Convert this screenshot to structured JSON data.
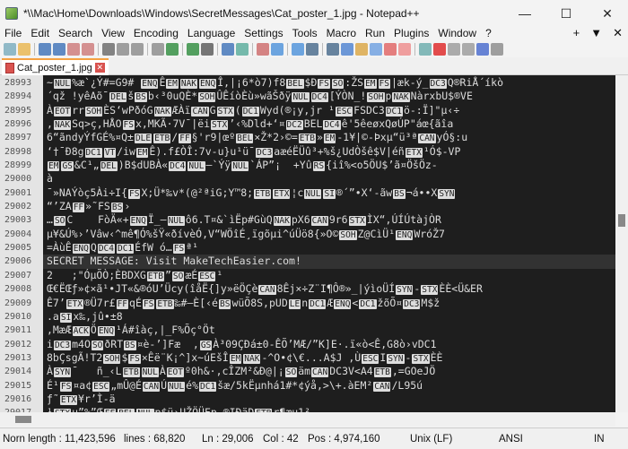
{
  "window": {
    "title": "*\\\\Mac\\Home\\Downloads\\Windows\\SecretMessages\\Cat_poster_1.jpg - Notepad++",
    "minimize": "—",
    "maximize": "☐",
    "close": "✕"
  },
  "menu": {
    "items": [
      "File",
      "Edit",
      "Search",
      "View",
      "Encoding",
      "Language",
      "Settings",
      "Tools",
      "Macro",
      "Run",
      "Plugins",
      "Window",
      "?"
    ],
    "right": [
      "+",
      "▼",
      "✕"
    ]
  },
  "toolbar": {
    "icons": [
      "new-file",
      "open-file",
      "save",
      "save-all",
      "close",
      "close-all",
      "print",
      "cut",
      "copy",
      "paste",
      "undo",
      "redo",
      "find",
      "replace",
      "zoom-in",
      "zoom-out",
      "sync-vertical",
      "sync-horizontal",
      "word-wrap",
      "show-all-chars",
      "indent-guide",
      "user-defined-language",
      "document-map",
      "function-list",
      "folder-as-workspace",
      "monitoring",
      "record-macro",
      "stop-recording",
      "playback-macro",
      "run-macro-multiple",
      "save-macro"
    ]
  },
  "tab": {
    "label": "Cat_poster_1.jpg",
    "close": "✕"
  },
  "editor": {
    "current_line": "29006",
    "lines": [
      {
        "n": "28993",
        "t": "~{NUL}%æ`¿Ý#=G9# {ENQ}Ê{EM}{NAK}{ENQ}Î‚|¡6*ò7)f8{BEL}$Ð{FS}{SO}:ŽS{EM}{FS}|æk-ý_{DC3}Q®RiÅ´íkò"
      },
      {
        "n": "28994",
        "t": "´qž !yêAõ¯{DEL}š{BS}b‹³0uQÈ*{SOH}ÛÊíòÈù»wãŠðÿ{NUL}{DC4}[ÝÒN_!{SOH}p{NAK}NàrxbU$®VE"
      },
      {
        "n": "28995",
        "t": "À{EOT}rr{SOH}ÈS‘wPðóG{NAK}ÆÀï{CAN}G{STX}({DC1}Wyd(®¡y,jr ¹{ESC}FSDC3{DC1}ö-:Ï]\"µ‹÷"
      },
      {
        "n": "28996",
        "t": ",{NAK}Sq>ç,HÅO{FS}x,MKÃ·7V¯|ëi{STX}’‹%Dld+‘¤{DC2}BEL{DC4}ê'5êeøxQøÚP\"áœ{ãîa"
      },
      {
        "n": "28997",
        "t": "6“ãndyÝfGÉ%¤Q±{DLE}{ETB}/{FF}§'r9|œº{BEL}×Ž*2›©={ETB}»{EM}-1¥|©-Þxµ“ü³ª{CAN}yÓ§:u"
      },
      {
        "n": "28998",
        "t": "‘†¯Ð8g{DC1}{VT}/iw{EM}Ê).f£ÒÎ:7v-u}u¹ü¯{DC3}aæéËÜû³+%š¿UdÒšê$V|éñ{ETX}¹Ó$-VP"
      },
      {
        "n": "28999",
        "t": "{EM}{GS}&C¹„{DEL})B$dUBÀ«{DC4}{NUL}—`Ýÿ{NUL}`ÁP”¡  +Yû{RS}{iî%<o5ÖU$’ã¤ÖšÖz-"
      },
      {
        "n": "29000",
        "t": "à"
      },
      {
        "n": "29001",
        "t": "¯»NAÝòç5Ài÷I{{FS}X;Ü*‰v*(@²ªiG;Y™8;{ETB}{ETX}¦c{NUL}{SI}®´”•X‘-ãw{BS}¬á••X{SYN}"
      },
      {
        "n": "29002",
        "t": "“’ZA{FF}»˜FS{BS}›"
      },
      {
        "n": "29003",
        "t": "…{SO}C    FòÄ«+{ENQ}Ï_—{NUL}ô6.T¤&`ìËp#GùQ{NAK}pX6{CAN}9r6{STX}ÌX“‚ÚÍÚtàjÒR"
      },
      {
        "n": "29004",
        "t": "µ¥&Ú%›’Vâw‹^mê¶Ó%šŸ«ðívèÓ,V“WÖîÉ¸ïgõµi^úÜö8{»O©{SOH}Z@CìÜ¹{ENQ}WróŽ7"
      },
      {
        "n": "29005",
        "t": "=ÀùÊ{ENQ}Q{DC4}{DC1}ÉfW ó…{FS}ª¹"
      },
      {
        "n": "29006",
        "t": "SECRET MESSAGE: Visit MakeTechEasier.com!"
      },
      {
        "n": "29007",
        "t": "2   ;\"ÓµÕÒ;ÈBDXG{ETB}”{SO}æÉ{ESC}¹"
      },
      {
        "n": "29008",
        "t": "Œ€ËŒƒ»¢×ã¹•JT«&®óU’Ücy(îåË{]y»ëÖÇè{CAN}8Êj×÷Z¨I¶Ô®»_|ýìoÜÍ{SYN}-{STX}ÈÈ<Ü&ER"
      },
      {
        "n": "29009",
        "t": "Ê7’{ETX}®Ü7r£{FF}qÉ{FS}{ETB}‰#—È[‹é{BS}wüÕ8S,pUD{LE}n{DC1}Æ{ENQ}<{DC1}žõÕ¤{DC3}M$ž"
      },
      {
        "n": "29010",
        "t": ".a{SI}x‰,jû•±8"
      },
      {
        "n": "29011",
        "t": ",MæÆ{ACK}Ö{ENQ}¹Á#îàç,|_F%Õç°Öt"
      },
      {
        "n": "29012",
        "t": "i{DC3}m4O{SO}ðRT{BS}¤è-’]Fæ  ‚{GS}À³09ÇÐá±0-ÊÕ’MÆ/”K]E·.ï«ò<Ê,G8ò›vDC1"
      },
      {
        "n": "29013",
        "t": "8bÇsgÃ!T2{SOH}${FS}×Êë¨K¡^]x~úEšÎ{EM}{NAK}-^O•¢\\€...A$J ,Ù{ESC}I{SYN}-{STX}ÈÈ"
      },
      {
        "n": "29014",
        "t": "À{SYN}¯   ñ_‹L{ETB}{NUL}À{EOT}º0h&·,cÎZM²&Ð@|¡{SO}äm{CAN}DC3V<A4{ETB},=GOeJÖ"
      },
      {
        "n": "29015",
        "t": "É¹{FS}¤a¢{ESC}„mÛ@É{CAN}Ú{NUL}é%{DC1}šæ/5kËµnhá1#*¢ýå,>\\+.àEM²{CAN}/L95ú"
      },
      {
        "n": "29016",
        "t": "ƒ˜{ETX}¥r’Ì-ä"
      },
      {
        "n": "29017",
        "t": "¹{STX}u”%”Œ{FF}{BEL}{NUL}p$ü›UŽÖÜFp ®IÐäD{ETB}r¶æu1²"
      }
    ]
  },
  "statusbar": {
    "length": "Norn length : 11,423,596",
    "lines": "lines : 68,820",
    "ln": "Ln : 29,006",
    "col": "Col : 42",
    "pos": "Pos : 4,974,160",
    "eol": "Unix (LF)",
    "encoding": "ANSI",
    "mode": "IN"
  },
  "colors": {
    "editor_bg": "#1e1e1e",
    "text": "#dcdcdc",
    "gutter_bg": "#e4e4e4",
    "tab_accent": "#f5a142"
  }
}
